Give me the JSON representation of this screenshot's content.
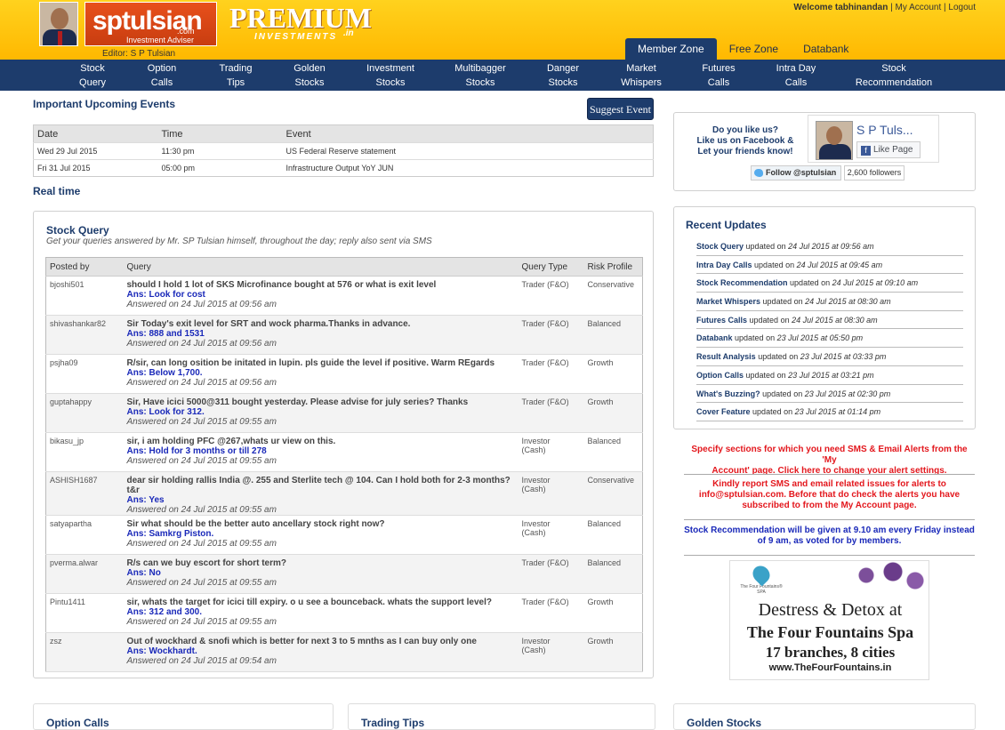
{
  "header": {
    "logo_text": "sptulsian",
    "logo_tld": ".com",
    "logo_tagline": "Investment Adviser",
    "editor_label": "Editor: S P Tulsian",
    "premium_logo": "PREMIUM",
    "premium_sub": "INVESTMENTS",
    "premium_tld": ".in",
    "welcome": "Welcome tabhinandan",
    "my_account": "My Account",
    "logout": "Logout",
    "separator": "|"
  },
  "zone_tabs": [
    "Member Zone",
    "Free Zone",
    "Databank"
  ],
  "nav": [
    {
      "l1": "Stock",
      "l2": "Query"
    },
    {
      "l1": "Option",
      "l2": "Calls"
    },
    {
      "l1": "Trading",
      "l2": "Tips"
    },
    {
      "l1": "Golden",
      "l2": "Stocks"
    },
    {
      "l1": "Investment",
      "l2": "Stocks"
    },
    {
      "l1": "Multibagger",
      "l2": "Stocks"
    },
    {
      "l1": "Danger",
      "l2": "Stocks"
    },
    {
      "l1": "Market",
      "l2": "Whispers"
    },
    {
      "l1": "Futures",
      "l2": "Calls"
    },
    {
      "l1": "Intra Day",
      "l2": "Calls"
    },
    {
      "l1": "Stock",
      "l2": "Recommendation"
    }
  ],
  "events": {
    "title": "Important Upcoming Events",
    "suggest_button": "Suggest Event",
    "columns": [
      "Date",
      "Time",
      "Event"
    ],
    "rows": [
      [
        "Wed 29 Jul 2015",
        "11:30 pm",
        "US Federal Reserve statement"
      ],
      [
        "Fri 31 Jul 2015",
        "05:00 pm",
        "Infrastructure Output YoY JUN"
      ]
    ]
  },
  "realtime_title": "Real time",
  "stock_query": {
    "title": "Stock Query",
    "subtitle": "Get your queries answered by Mr. SP Tulsian himself, throughout the day; reply also sent via SMS",
    "columns": [
      "Posted by",
      "Query",
      "Query Type",
      "Risk Profile"
    ],
    "rows": [
      {
        "user": "bjoshi501",
        "q": "should I hold 1 lot of SKS Microfinance bought at 576 or what is exit level",
        "a": "Ans: Look for cost",
        "t": "Answered on 24 Jul 2015 at 09:56 am",
        "type1": "Trader (F&O)",
        "type2": "",
        "risk": "Conservative"
      },
      {
        "user": "shivashankar82",
        "q": "Sir Today's exit level for SRT and wock pharma.Thanks in advance.",
        "a": "Ans: 888 and 1531",
        "t": "Answered on 24 Jul 2015 at 09:56 am",
        "type1": "Trader (F&O)",
        "type2": "",
        "risk": "Balanced"
      },
      {
        "user": "psjha09",
        "q": "R/sir, can long osition be initated in lupin. pls guide the level if positive. Warm REgards",
        "a": "Ans: Below 1,700.",
        "t": "Answered on 24 Jul 2015 at 09:56 am",
        "type1": "Trader (F&O)",
        "type2": "",
        "risk": "Growth"
      },
      {
        "user": "guptahappy",
        "q": "Sir, Have icici 5000@311 bought yesterday. Please advise for july series? Thanks",
        "a": "Ans: Look for 312.",
        "t": "Answered on 24 Jul 2015 at 09:55 am",
        "type1": "Trader (F&O)",
        "type2": "",
        "risk": "Growth"
      },
      {
        "user": "bikasu_jp",
        "q": "sir, i am holding PFC @267,whats ur view on this.",
        "a": "Ans: Hold for 3 months or till 278",
        "t": "Answered on 24 Jul 2015 at 09:55 am",
        "type1": "Investor",
        "type2": "(Cash)",
        "risk": "Balanced"
      },
      {
        "user": "ASHISH1687",
        "q": "dear sir holding rallis India @. 255 and Sterlite tech @ 104. Can I hold both for 2-3 months?t&r",
        "a": "Ans: Yes",
        "t": "Answered on 24 Jul 2015 at 09:55 am",
        "type1": "Investor",
        "type2": "(Cash)",
        "risk": "Conservative"
      },
      {
        "user": "satyapartha",
        "q": "Sir what should be the better auto ancellary stock right now?",
        "a": "Ans: Samkrg Piston.",
        "t": "Answered on 24 Jul 2015 at 09:55 am",
        "type1": "Investor",
        "type2": "(Cash)",
        "risk": "Balanced"
      },
      {
        "user": "pverma.alwar",
        "q": "R/s can we buy escort for short term?",
        "a": "Ans: No",
        "t": "Answered on 24 Jul 2015 at 09:55 am",
        "type1": "Trader (F&O)",
        "type2": "",
        "risk": "Balanced"
      },
      {
        "user": "Pintu1411",
        "q": "sir, whats the target for icici till expiry. o u see a bounceback. whats the support level?",
        "a": "Ans: 312 and 300.",
        "t": "Answered on 24 Jul 2015 at 09:55 am",
        "type1": "Trader (F&O)",
        "type2": "",
        "risk": "Growth"
      },
      {
        "user": "zsz",
        "q": "Out of wockhard & snofi which is better for next 3 to 5 mnths as I can buy only one",
        "a": "Ans: Wockhardt.",
        "t": "Answered on 24 Jul 2015 at 09:54 am",
        "type1": "Investor",
        "type2": "(Cash)",
        "risk": "Growth"
      }
    ]
  },
  "bottom_boxes": [
    "Option Calls",
    "Trading Tips",
    "Golden Stocks"
  ],
  "social": {
    "ask_l1": "Do you like us?",
    "ask_l2": "Like us on Facebook &",
    "ask_l3": "Let your friends know!",
    "fb_name": "S P Tuls...",
    "like_label": "Like Page",
    "follow_label": "Follow @sptulsian",
    "followers": "2,600 followers"
  },
  "recent_updates": {
    "title": "Recent Updates",
    "items": [
      {
        "name": "Stock Query",
        "date": "24 Jul 2015 at 09:56 am"
      },
      {
        "name": "Intra Day Calls",
        "date": "24 Jul 2015 at 09:45 am"
      },
      {
        "name": "Stock Recommendation",
        "date": "24 Jul 2015 at 09:10 am"
      },
      {
        "name": "Market Whispers",
        "date": "24 Jul 2015 at 08:30 am"
      },
      {
        "name": "Futures Calls",
        "date": "24 Jul 2015 at 08:30 am"
      },
      {
        "name": "Databank",
        "date": "23 Jul 2015 at 05:50 pm"
      },
      {
        "name": "Result Analysis",
        "date": "23 Jul 2015 at 03:33 pm"
      },
      {
        "name": "Option Calls",
        "date": "23 Jul 2015 at 03:21 pm"
      },
      {
        "name": "What's Buzzing?",
        "date": "23 Jul 2015 at 02:30 pm"
      },
      {
        "name": "Cover Feature",
        "date": "23 Jul 2015 at 01:14 pm"
      }
    ],
    "updated_on": "updated on"
  },
  "notices": {
    "alerts_l1": "Specify sections for which you need SMS & Email Alerts from the 'My",
    "alerts_l2a": "Account' page.",
    "alerts_link": "Click here",
    "alerts_l2b": "to change your alert settings.",
    "report_l1": "Kindly report SMS and email related issues for alerts to",
    "report_l2": "info@sptulsian.com. Before that do check the alerts you have",
    "report_l3": "subscribed to from the My Account page.",
    "reco_l1": "Stock Recommendation will be given at 9.10 am every Friday instead",
    "reco_l2": "of 9 am, as voted for by members."
  },
  "ad": {
    "brand": "The Four Fountains® SPA",
    "line1": "Destress & Detox at",
    "line2": "The Four Fountains Spa",
    "line3": "17 branches, 8 cities",
    "line4": "www.TheFourFountains.in"
  },
  "colors": {
    "brand_navy": "#1d3c6c",
    "header_yellow": "#ffc20e",
    "alert_red": "#e3171d",
    "link_blue": "#1a29b9"
  }
}
